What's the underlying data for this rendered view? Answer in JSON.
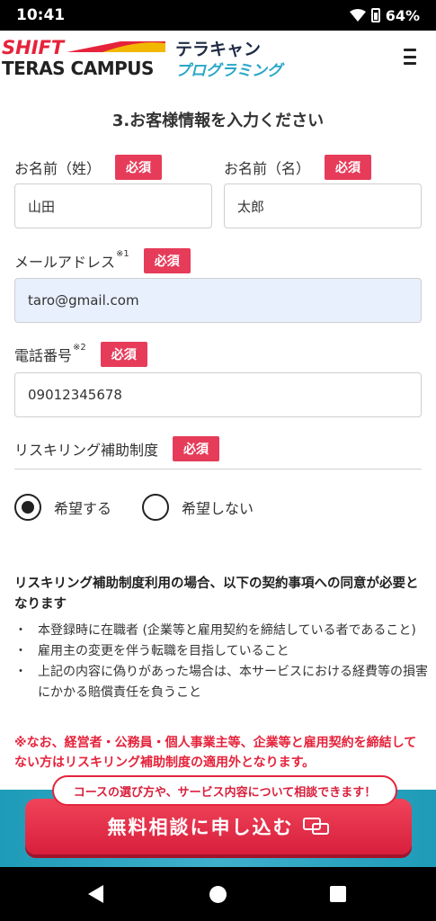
{
  "status_bar": {
    "time": "10:41",
    "battery": "64%"
  },
  "header": {
    "logo_shift": "SHIFT",
    "logo_teras": "TERAS CAMPUS",
    "logo_terakyan": "テラキャン",
    "logo_programming": "プログラミング"
  },
  "form": {
    "section_title": "3.お客様情報を入力ください",
    "required_label": "必須",
    "last_name": {
      "label": "お名前（姓）",
      "value": "山田"
    },
    "first_name": {
      "label": "お名前（名）",
      "value": "太郎"
    },
    "email": {
      "label": "メールアドレス",
      "note": "※1",
      "value": "taro@gmail.com"
    },
    "phone": {
      "label": "電話番号",
      "note": "※2",
      "value": "09012345678"
    },
    "reskilling": {
      "label": "リスキリング補助制度",
      "options": [
        "希望する",
        "希望しない"
      ],
      "selected": "希望する"
    }
  },
  "notice": {
    "title": "リスキリング補助制度利用の場合、以下の契約事項への同意が必要となります",
    "items": [
      "本登録時に在職者 (企業等と雇用契約を締結している者であること)",
      "雇用主の変更を伴う転職を目指していること",
      "上記の内容に偽りがあった場合は、本サービスにおける経費等の損害にかかる賠償責任を負うこと"
    ],
    "warning": "※なお、経営者・公務員・個人事業主等、企業等と雇用契約を締結してない方はリスキリング補助制度の適用外となります。"
  },
  "cta": {
    "bubble": "コースの選び方や、サービス内容について相談できます！",
    "button": "無料相談に申し込む"
  },
  "colors": {
    "accent_red": "#e5233b",
    "badge_pink": "#e63c5a",
    "teal": "#29a7c7",
    "autofill_blue": "#e8f0fe"
  }
}
